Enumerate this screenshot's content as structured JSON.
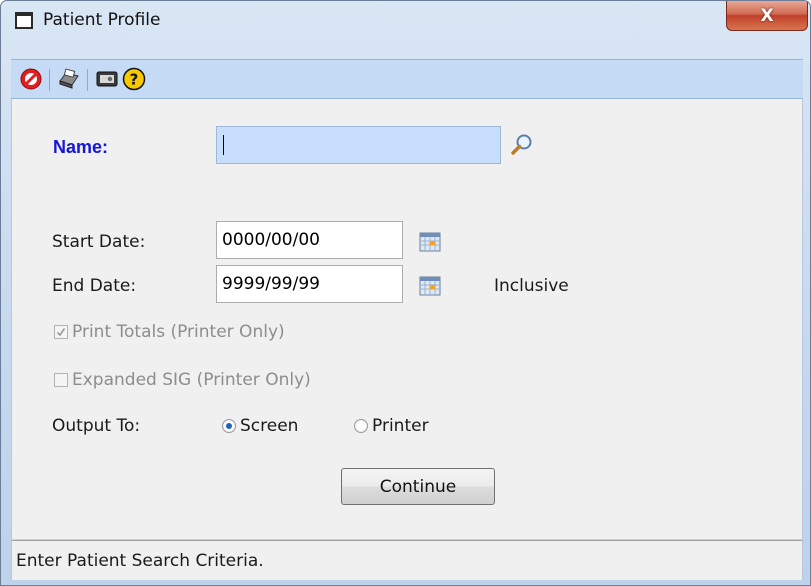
{
  "window": {
    "title": "Patient Profile",
    "close_label": "X"
  },
  "toolbar": {
    "items": [
      {
        "icon": "stop-icon"
      },
      {
        "icon": "printer-icon"
      },
      {
        "icon": "screen-icon"
      },
      {
        "icon": "help-icon"
      }
    ]
  },
  "form": {
    "name_label": "Name:",
    "name_value": "",
    "start_date_label": "Start Date:",
    "start_date_value": "0000/00/00",
    "end_date_label": "End Date:",
    "end_date_value": "9999/99/99",
    "inclusive_label": "Inclusive",
    "print_totals_label": "Print Totals (Printer Only)",
    "print_totals_checked": true,
    "expanded_sig_label": "Expanded SIG (Printer Only)",
    "expanded_sig_checked": false,
    "output_label": "Output To:",
    "output_options": [
      "Screen",
      "Printer"
    ],
    "output_selected": "Screen",
    "continue_label": "Continue"
  },
  "status": {
    "text": "Enter Patient Search Criteria."
  },
  "colors": {
    "name_label": "#1515d8",
    "toolbar_bg": "#c5dbf5",
    "name_input_bg": "#c7dffc",
    "close_button": "#c9442c"
  }
}
